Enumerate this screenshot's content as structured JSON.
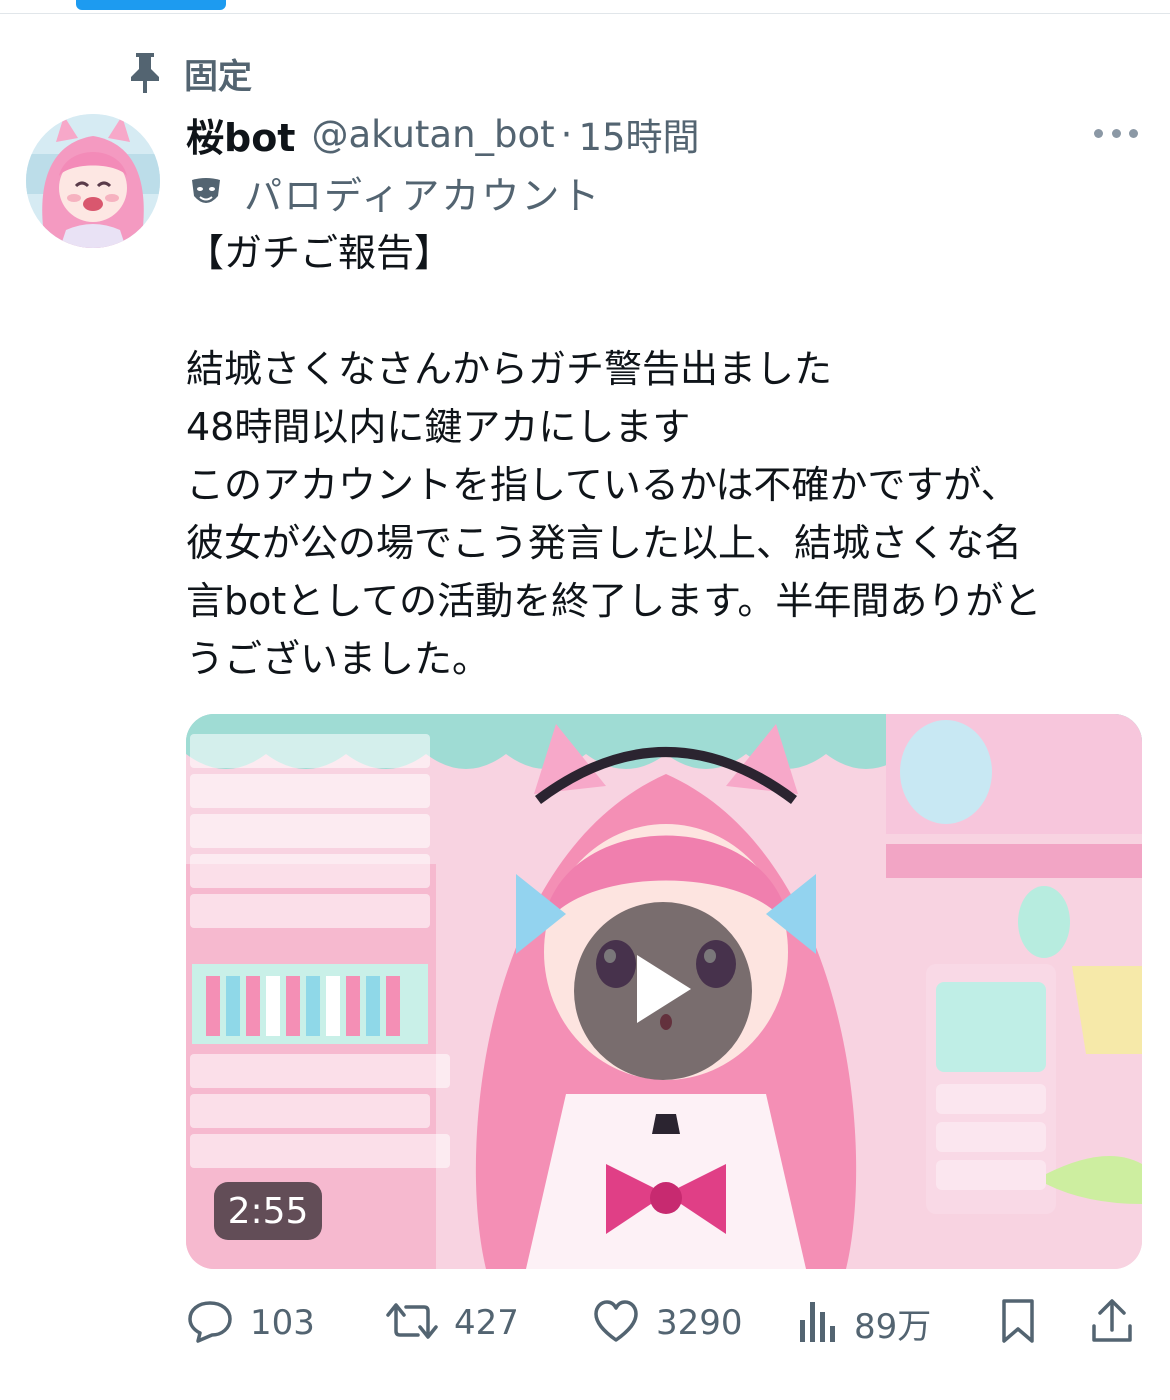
{
  "pinned": {
    "label": "固定",
    "icon": "pin-icon"
  },
  "author": {
    "display_name": "桜bot",
    "handle": "@akutan_bot",
    "separator": "·",
    "time": "15時間",
    "badge": {
      "icon": "mask-icon",
      "label": "パロディアカウント"
    }
  },
  "tweet": {
    "lines": [
      "【ガチご報告】",
      "",
      "結城さくなさんからガチ警告出ました",
      "48時間以内に鍵アカにします",
      "このアカウントを指しているかは不確かですが、",
      "彼女が公の場でこう発言した以上、結城さくな名",
      "言botとしての活動を終了します。半年間ありがと",
      "うございました。"
    ]
  },
  "media": {
    "duration": "2:55",
    "play_icon": "play-icon"
  },
  "actions": {
    "reply": {
      "icon": "reply-icon",
      "count": "103"
    },
    "retweet": {
      "icon": "retweet-icon",
      "count": "427"
    },
    "like": {
      "icon": "heart-icon",
      "count": "3290"
    },
    "views": {
      "icon": "views-icon",
      "count": "89万"
    },
    "bookmark": {
      "icon": "bookmark-icon"
    },
    "share": {
      "icon": "share-icon"
    }
  },
  "colors": {
    "accent": "#1d9bf0",
    "secondary_text": "#536471",
    "primary_text": "#0f1419"
  }
}
